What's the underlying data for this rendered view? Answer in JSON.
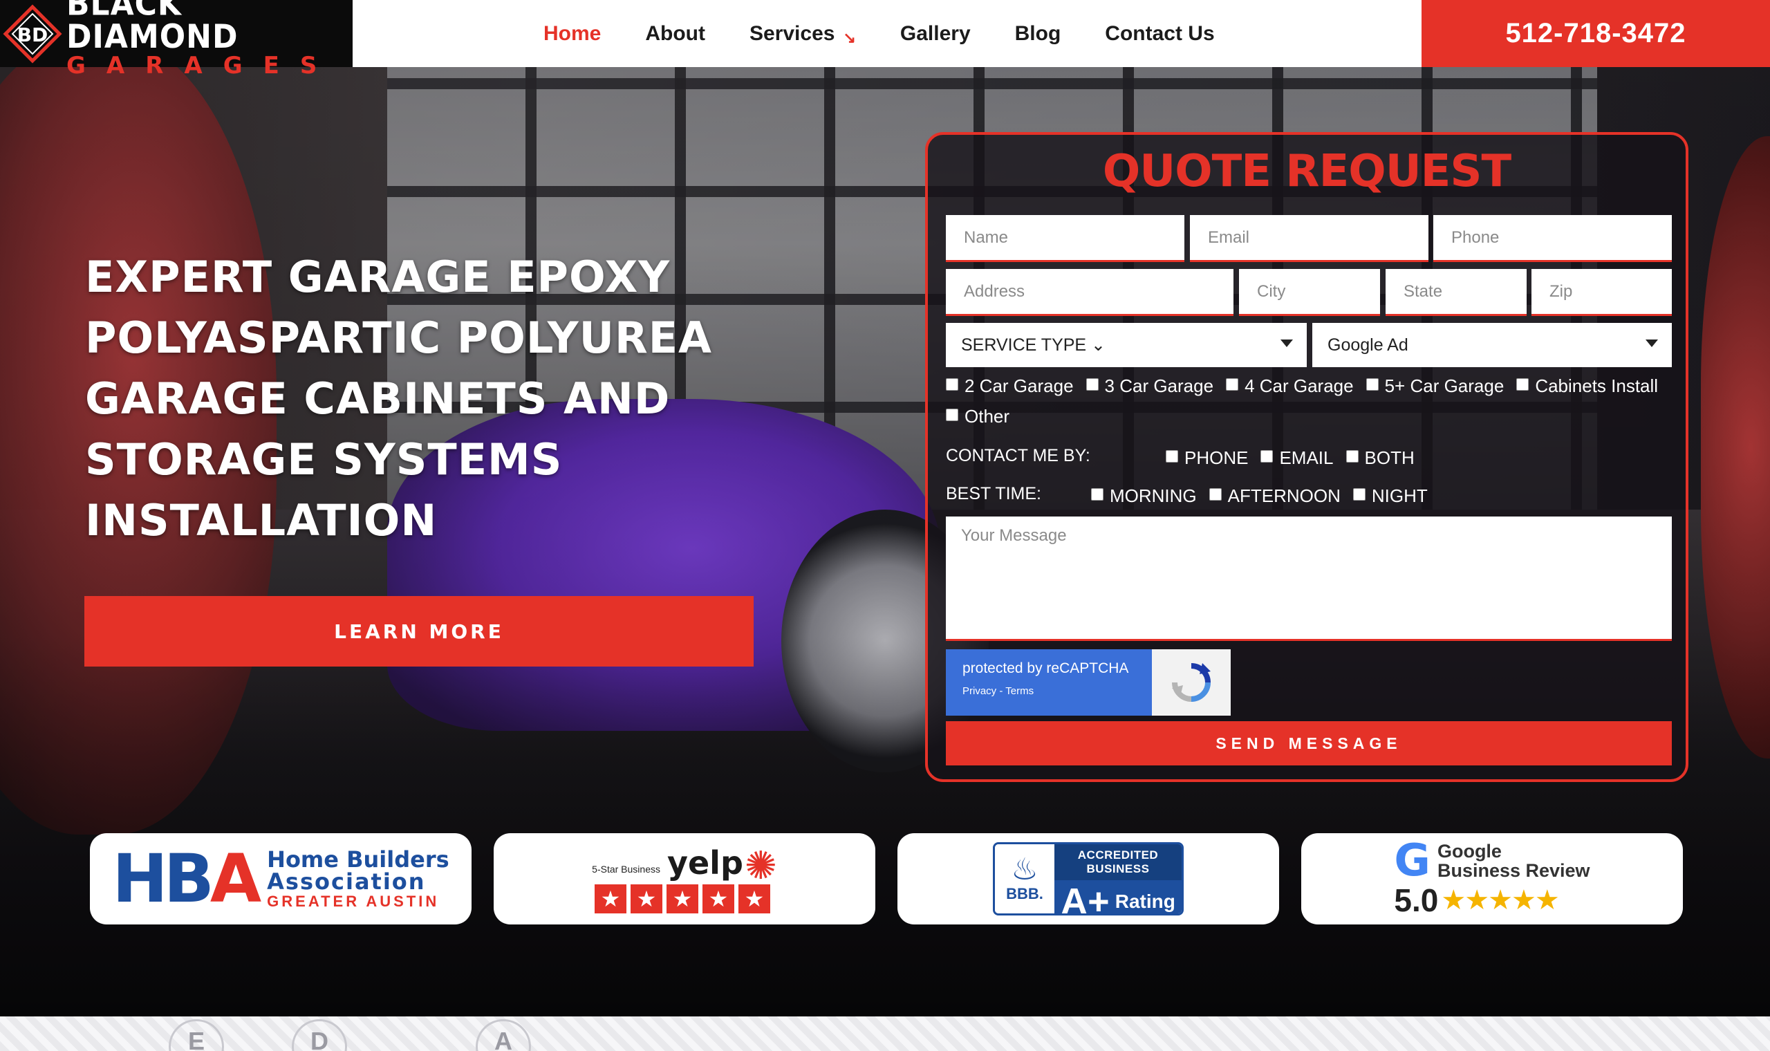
{
  "header": {
    "logo": {
      "line1": "BLACK DIAMOND",
      "line2": "GARAGES",
      "mark": "BD"
    },
    "nav": [
      {
        "label": "Home",
        "active": true
      },
      {
        "label": "About"
      },
      {
        "label": "Services",
        "has_dropdown": true,
        "arrow": "↘"
      },
      {
        "label": "Gallery"
      },
      {
        "label": "Blog"
      },
      {
        "label": "Contact Us"
      }
    ],
    "phone": "512-718-3472",
    "colors": {
      "accent": "#e53228",
      "logo_bg": "#0b0b0b"
    }
  },
  "hero": {
    "headline": [
      "EXPERT GARAGE EPOXY",
      "POLYASPARTIC POLYUREA",
      "GARAGE CABINETS AND",
      "STORAGE SYSTEMS",
      "INSTALLATION"
    ],
    "cta": "LEARN MORE"
  },
  "quote_form": {
    "title": "QUOTE REQUEST",
    "placeholders": {
      "name": "Name",
      "email": "Email",
      "phone": "Phone",
      "address": "Address",
      "city": "City",
      "state": "State",
      "zip": "Zip",
      "message": "Your Message"
    },
    "service_type": "SERVICE TYPE ⌄",
    "source": "Google Ad",
    "garage_options": [
      "2 Car Garage",
      "3 Car Garage",
      "4 Car Garage",
      "5+ Car Garage",
      "Cabinets Install",
      "Other"
    ],
    "contact_label": "CONTACT ME BY:",
    "contact_options": [
      "PHONE",
      "EMAIL",
      "BOTH"
    ],
    "time_label": "BEST TIME:",
    "time_options": [
      "MORNING",
      "AFTERNOON",
      "NIGHT"
    ],
    "recaptcha": {
      "line1": "protected by reCAPTCHA",
      "line2": "Privacy - Terms"
    },
    "submit": "SEND MESSAGE"
  },
  "badges": {
    "hba": {
      "letters_h": "H",
      "letters_b": "B",
      "letters_a": "A",
      "line1": "Home Builders",
      "line2": "Association",
      "line3": "GREATER AUSTIN"
    },
    "yelp": {
      "small": "5-Star Business",
      "word": "yelp",
      "stars": "★"
    },
    "bbb": {
      "accredited": "ACCREDITED BUSINESS",
      "grade": "A+",
      "rating": "Rating",
      "label": "BBB."
    },
    "google": {
      "g": "G",
      "line1": "Google",
      "line2": "Business Review",
      "score": "5.0",
      "stars": "★★★★★"
    }
  },
  "footer_strip": {
    "letters": [
      "E",
      "D",
      "A"
    ]
  }
}
